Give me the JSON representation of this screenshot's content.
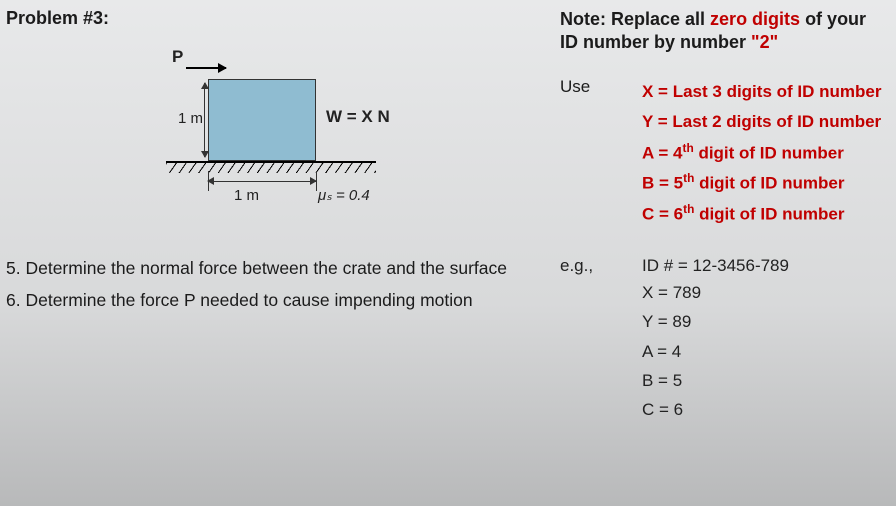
{
  "title": "Problem #3:",
  "note_prefix": "Note: Replace all ",
  "note_red1": "zero digits",
  "note_mid": " of your ID number by number ",
  "note_red2": "\"2\"",
  "figure": {
    "p_label": "P",
    "height": "1 m",
    "weight": "W =  X  N",
    "base": "1 m",
    "mu": "μₛ = 0.4"
  },
  "q5": "5. Determine the normal force between the crate and the surface",
  "q6": "6. Determine the force P needed to cause impending motion",
  "use_label": "Use",
  "defs": {
    "x": "X = Last 3 digits of ID number",
    "y": "Y = Last 2 digits of ID number",
    "a_pre": "A = 4",
    "a_suf": " digit of ID number",
    "b_pre": "B = 5",
    "b_suf": " digit of ID number",
    "c_pre": "C = 6",
    "c_suf": " digit of ID number",
    "th": "th"
  },
  "eg_label": "e.g.,",
  "eg_id": "ID # = 12-3456-789",
  "eg": {
    "x": "X = 789",
    "y": "Y = 89",
    "a": "A = 4",
    "b": "B = 5",
    "c": "C = 6"
  }
}
